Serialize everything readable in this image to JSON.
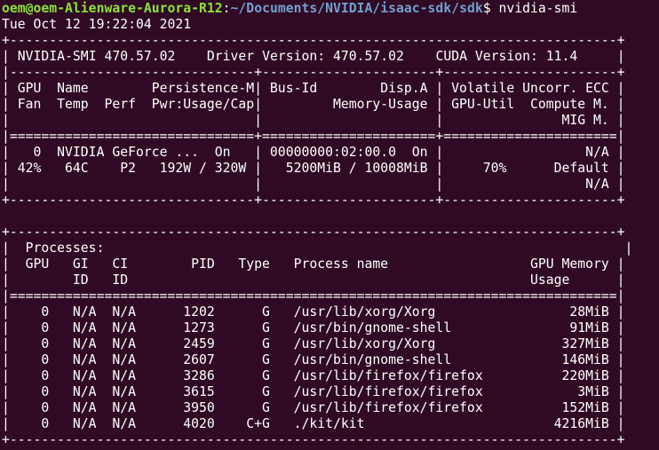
{
  "prompt": {
    "user_host": "oem@oem-Alienware-Aurora-R12",
    "separator": ":",
    "path": "~/Documents/NVIDIA/isaac-sdk/sdk",
    "symbol": "$ ",
    "command": "nvidia-smi"
  },
  "timestamp": "Tue Oct 12 19:22:04 2021",
  "header": {
    "smi_version": "NVIDIA-SMI 470.57.02",
    "driver_version": "Driver Version: 470.57.02",
    "cuda_version": "CUDA Version: 11.4"
  },
  "gpu_table": {
    "col_headers": [
      "| GPU  Name        Persistence-M| Bus-Id        Disp.A | Volatile Uncorr. ECC |",
      "| Fan  Temp  Perf  Pwr:Usage/Cap|         Memory-Usage | GPU-Util  Compute M. |",
      "|                               |                      |               MIG M. |"
    ],
    "rows": [
      "|   0  NVIDIA GeForce ...  On   | 00000000:02:00.0  On |                  N/A |",
      "| 42%   64C    P2   192W / 320W |   5200MiB / 10008MiB |     70%      Default |",
      "|                               |                      |                  N/A |"
    ]
  },
  "processes": {
    "title": "|  Processes:                                                                  |",
    "col_headers": [
      "|  GPU   GI   CI        PID   Type   Process name                  GPU Memory |",
      "|        ID   ID                                                   Usage      |"
    ],
    "rows": [
      "|    0   N/A  N/A      1202      G   /usr/lib/xorg/Xorg                 28MiB |",
      "|    0   N/A  N/A      1273      G   /usr/bin/gnome-shell               91MiB |",
      "|    0   N/A  N/A      2459      G   /usr/lib/xorg/Xorg                327MiB |",
      "|    0   N/A  N/A      2607      G   /usr/bin/gnome-shell              146MiB |",
      "|    0   N/A  N/A      3286      G   /usr/lib/firefox/firefox          220MiB |",
      "|    0   N/A  N/A      3615      G   /usr/lib/firefox/firefox            3MiB |",
      "|    0   N/A  N/A      3950      G   /usr/lib/firefox/firefox          152MiB |",
      "|    0   N/A  N/A      4020    C+G   ./kit/kit                        4216MiB |"
    ]
  },
  "borders": {
    "top": "+-----------------------------------------------------------------------------+",
    "gpu_mid": "|-------------------------------+----------------------+----------------------+",
    "gpu_sep": "|===============================+======================+======================|",
    "gpu_bottom": "+-------------------------------+----------------------+----------------------+",
    "proc_sep": "|=============================================================================|",
    "empty": ""
  },
  "colors": {
    "background": "#300a24",
    "text": "#ffffff",
    "user_host": "#8ae234",
    "path": "#729fcf"
  }
}
